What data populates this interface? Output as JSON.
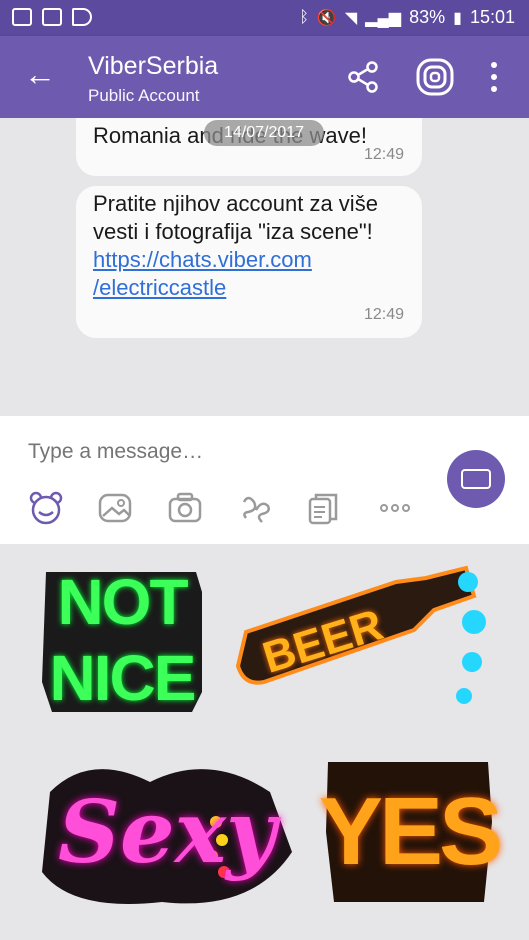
{
  "status_bar": {
    "battery": "83%",
    "time": "15:01"
  },
  "header": {
    "title": "ViberSerbia",
    "subtitle": "Public Account"
  },
  "chat": {
    "date_pill": "14/07/2017",
    "messages": [
      {
        "text": "Romania and ride the wave!",
        "time": "12:49"
      },
      {
        "text": "Pratite njihov account za više vesti i fotografija \"iza scene\"!",
        "link_line1": "https://chats.viber.com",
        "link_line2": "/electriccastle",
        "time": "12:49"
      }
    ]
  },
  "composer": {
    "placeholder": "Type a message…"
  },
  "stickers": {
    "not_nice": {
      "line1": "NOT",
      "line2": "NICE"
    },
    "beer": "BEER",
    "sexy": "Sexy",
    "yes": "YES"
  },
  "colors": {
    "brand": "#6e5bb0",
    "status": "#5b4a9e",
    "link": "#2f6fd6"
  }
}
